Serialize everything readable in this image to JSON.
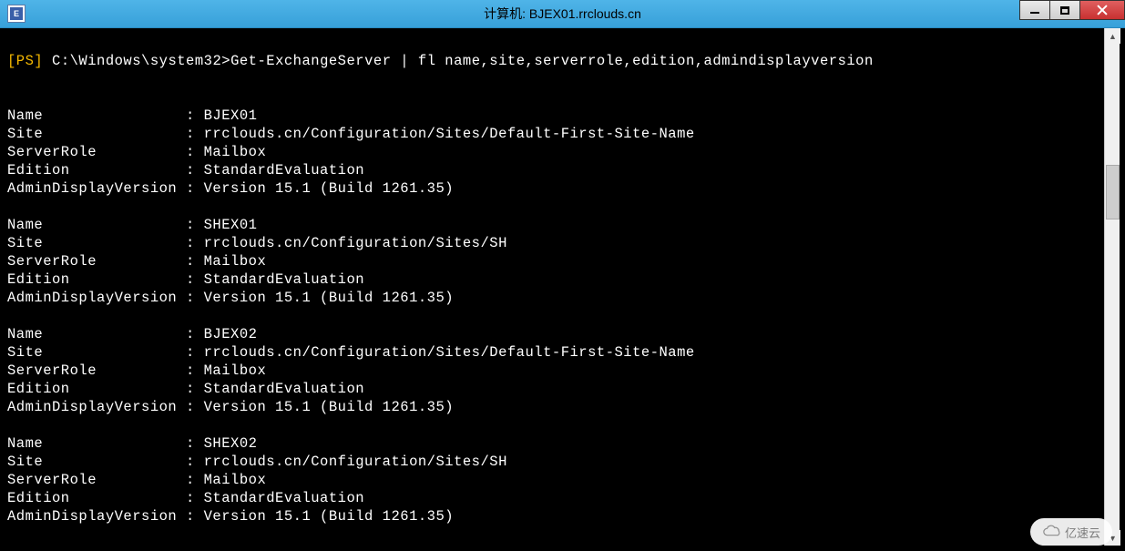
{
  "window": {
    "title": "计算机: BJEX01.rrclouds.cn",
    "icon_label": "E"
  },
  "prompt": {
    "ps_tag": "[PS]",
    "path": " C:\\Windows\\system32>",
    "command": "Get-ExchangeServer | fl name,site,serverrole,edition,admindisplayversion"
  },
  "field_labels": {
    "name": "Name",
    "site": "Site",
    "serverrole": "ServerRole",
    "edition": "Edition",
    "admindisplayversion": "AdminDisplayVersion"
  },
  "servers": [
    {
      "Name": "BJEX01",
      "Site": "rrclouds.cn/Configuration/Sites/Default-First-Site-Name",
      "ServerRole": "Mailbox",
      "Edition": "StandardEvaluation",
      "AdminDisplayVersion": "Version 15.1 (Build 1261.35)"
    },
    {
      "Name": "SHEX01",
      "Site": "rrclouds.cn/Configuration/Sites/SH",
      "ServerRole": "Mailbox",
      "Edition": "StandardEvaluation",
      "AdminDisplayVersion": "Version 15.1 (Build 1261.35)"
    },
    {
      "Name": "BJEX02",
      "Site": "rrclouds.cn/Configuration/Sites/Default-First-Site-Name",
      "ServerRole": "Mailbox",
      "Edition": "StandardEvaluation",
      "AdminDisplayVersion": "Version 15.1 (Build 1261.35)"
    },
    {
      "Name": "SHEX02",
      "Site": "rrclouds.cn/Configuration/Sites/SH",
      "ServerRole": "Mailbox",
      "Edition": "StandardEvaluation",
      "AdminDisplayVersion": "Version 15.1 (Build 1261.35)"
    }
  ],
  "watermark": {
    "text": "亿速云"
  }
}
